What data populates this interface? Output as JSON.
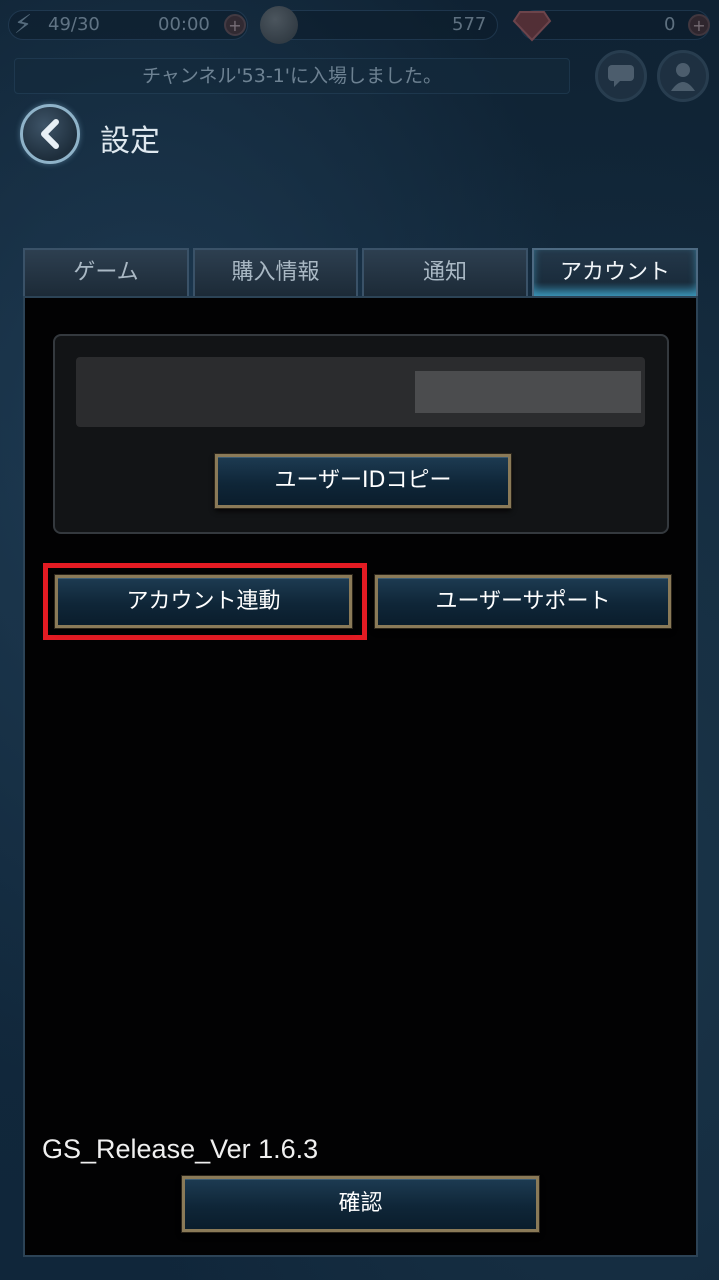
{
  "status_bar": {
    "stamina": "49/30",
    "timer": "00:00",
    "gold": "577",
    "gems": "0",
    "notice": "チャンネル'53-1'に入場しました。"
  },
  "header": {
    "title": "設定"
  },
  "tabs": [
    {
      "label": "ゲーム",
      "active": false
    },
    {
      "label": "購入情報",
      "active": false
    },
    {
      "label": "通知",
      "active": false
    },
    {
      "label": "アカウント",
      "active": true
    }
  ],
  "account": {
    "copy_id_label": "ユーザーIDコピー",
    "link_account_label": "アカウント連動",
    "support_label": "ユーザーサポート"
  },
  "footer": {
    "version": "GS_Release_Ver 1.6.3",
    "confirm_label": "確認"
  },
  "colors": {
    "highlight": "#e31b23",
    "button_border": "#8a7a58",
    "panel_bg": "#020203"
  }
}
